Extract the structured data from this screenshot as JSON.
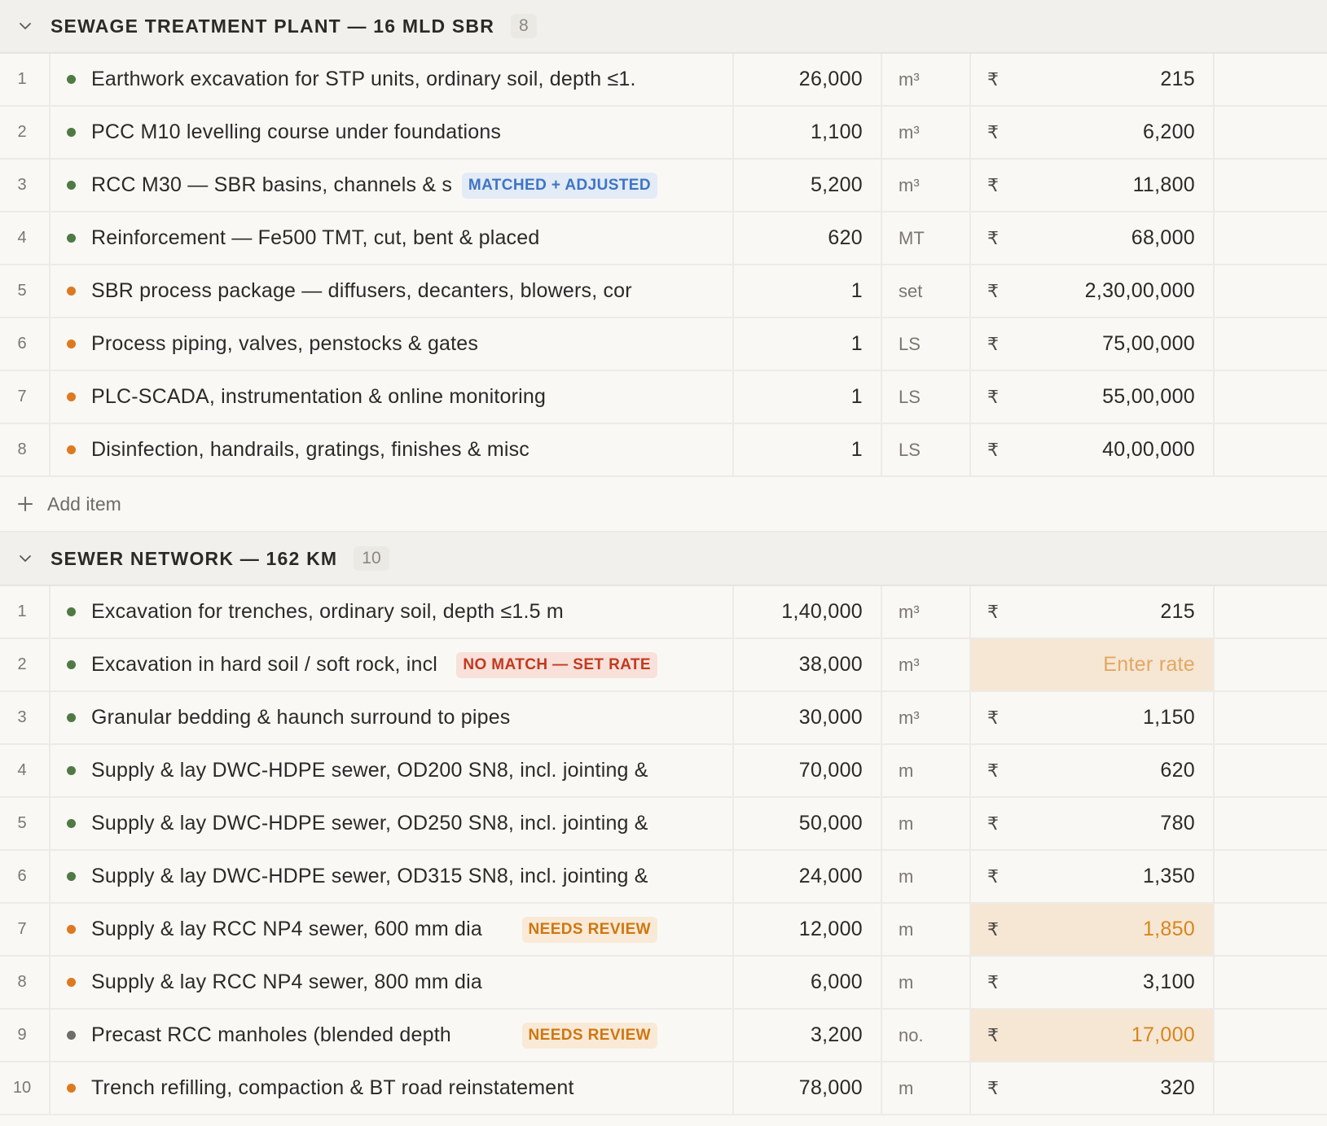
{
  "groups": [
    {
      "title": "SEWAGE TREATMENT PLANT — 16 MLD SBR",
      "count": "8",
      "add_label": "Add item",
      "rows": [
        {
          "num": "1",
          "dot": "green",
          "desc": "Earthwork excavation for STP units, ordinary soil, depth ≤1.",
          "badge": null,
          "qty": "26,000",
          "unit": "m³",
          "currency": "₹",
          "rate": "215",
          "rate_state": "normal"
        },
        {
          "num": "2",
          "dot": "green",
          "desc": "PCC M10 levelling course under foundations",
          "badge": null,
          "qty": "1,100",
          "unit": "m³",
          "currency": "₹",
          "rate": "6,200",
          "rate_state": "normal"
        },
        {
          "num": "3",
          "dot": "green",
          "desc": "RCC M30 — SBR basins, channels & s",
          "badge": {
            "text": "MATCHED + ADJUSTED",
            "kind": "matched"
          },
          "qty": "5,200",
          "unit": "m³",
          "currency": "₹",
          "rate": "11,800",
          "rate_state": "normal"
        },
        {
          "num": "4",
          "dot": "green",
          "desc": "Reinforcement — Fe500 TMT, cut, bent & placed",
          "badge": null,
          "qty": "620",
          "unit": "MT",
          "currency": "₹",
          "rate": "68,000",
          "rate_state": "normal"
        },
        {
          "num": "5",
          "dot": "orange",
          "desc": "SBR process package — diffusers, decanters, blowers, cor",
          "badge": null,
          "qty": "1",
          "unit": "set",
          "currency": "₹",
          "rate": "2,30,00,000",
          "rate_state": "normal"
        },
        {
          "num": "6",
          "dot": "orange",
          "desc": "Process piping, valves, penstocks & gates",
          "badge": null,
          "qty": "1",
          "unit": "LS",
          "currency": "₹",
          "rate": "75,00,000",
          "rate_state": "normal"
        },
        {
          "num": "7",
          "dot": "orange",
          "desc": "PLC-SCADA, instrumentation & online monitoring",
          "badge": null,
          "qty": "1",
          "unit": "LS",
          "currency": "₹",
          "rate": "55,00,000",
          "rate_state": "normal"
        },
        {
          "num": "8",
          "dot": "orange",
          "desc": "Disinfection, handrails, gratings, finishes & misc",
          "badge": null,
          "qty": "1",
          "unit": "LS",
          "currency": "₹",
          "rate": "40,00,000",
          "rate_state": "normal"
        }
      ]
    },
    {
      "title": "SEWER NETWORK — 162 KM",
      "count": "10",
      "add_label": "",
      "rows": [
        {
          "num": "1",
          "dot": "green",
          "desc": "Excavation for trenches, ordinary soil, depth ≤1.5 m",
          "badge": null,
          "qty": "1,40,000",
          "unit": "m³",
          "currency": "₹",
          "rate": "215",
          "rate_state": "normal"
        },
        {
          "num": "2",
          "dot": "green",
          "desc": "Excavation in hard soil / soft rock, incl",
          "badge": {
            "text": "NO MATCH — SET RATE",
            "kind": "nomatch"
          },
          "qty": "38,000",
          "unit": "m³",
          "currency": "",
          "rate": "Enter rate",
          "rate_state": "empty"
        },
        {
          "num": "3",
          "dot": "green",
          "desc": "Granular bedding & haunch surround to pipes",
          "badge": null,
          "qty": "30,000",
          "unit": "m³",
          "currency": "₹",
          "rate": "1,150",
          "rate_state": "normal"
        },
        {
          "num": "4",
          "dot": "green",
          "desc": "Supply & lay DWC-HDPE sewer, OD200 SN8, incl. jointing &",
          "badge": null,
          "qty": "70,000",
          "unit": "m",
          "currency": "₹",
          "rate": "620",
          "rate_state": "normal"
        },
        {
          "num": "5",
          "dot": "green",
          "desc": "Supply & lay DWC-HDPE sewer, OD250 SN8, incl. jointing &",
          "badge": null,
          "qty": "50,000",
          "unit": "m",
          "currency": "₹",
          "rate": "780",
          "rate_state": "normal"
        },
        {
          "num": "6",
          "dot": "green",
          "desc": "Supply & lay DWC-HDPE sewer, OD315 SN8, incl. jointing &",
          "badge": null,
          "qty": "24,000",
          "unit": "m",
          "currency": "₹",
          "rate": "1,350",
          "rate_state": "normal"
        },
        {
          "num": "7",
          "dot": "orange",
          "desc": "Supply & lay RCC NP4 sewer, 600 mm dia",
          "badge": {
            "text": "NEEDS REVIEW",
            "kind": "review"
          },
          "qty": "12,000",
          "unit": "m",
          "currency": "₹",
          "rate": "1,850",
          "rate_state": "highlight"
        },
        {
          "num": "8",
          "dot": "orange",
          "desc": "Supply & lay RCC NP4 sewer, 800 mm dia",
          "badge": null,
          "qty": "6,000",
          "unit": "m",
          "currency": "₹",
          "rate": "3,100",
          "rate_state": "normal"
        },
        {
          "num": "9",
          "dot": "gray",
          "desc": "Precast RCC manholes (blended depths), inc",
          "badge": {
            "text": "NEEDS REVIEW",
            "kind": "review"
          },
          "qty": "3,200",
          "unit": "no.",
          "currency": "₹",
          "rate": "17,000",
          "rate_state": "highlight"
        },
        {
          "num": "10",
          "dot": "orange",
          "desc": "Trench refilling, compaction & BT road reinstatement",
          "badge": null,
          "qty": "78,000",
          "unit": "m",
          "currency": "₹",
          "rate": "320",
          "rate_state": "normal"
        }
      ]
    }
  ],
  "icons": {
    "collapse": "chevron-down-icon",
    "add": "plus-icon"
  },
  "colors": {
    "dot_green": "#4f7a44",
    "dot_orange": "#dd7a1f",
    "dot_gray": "#6f6d68",
    "matched_badge": "#3e74c4",
    "nomatch_badge": "#c2391f",
    "review_badge": "#d07610",
    "rate_highlight_bg": "#f6e6d4"
  }
}
